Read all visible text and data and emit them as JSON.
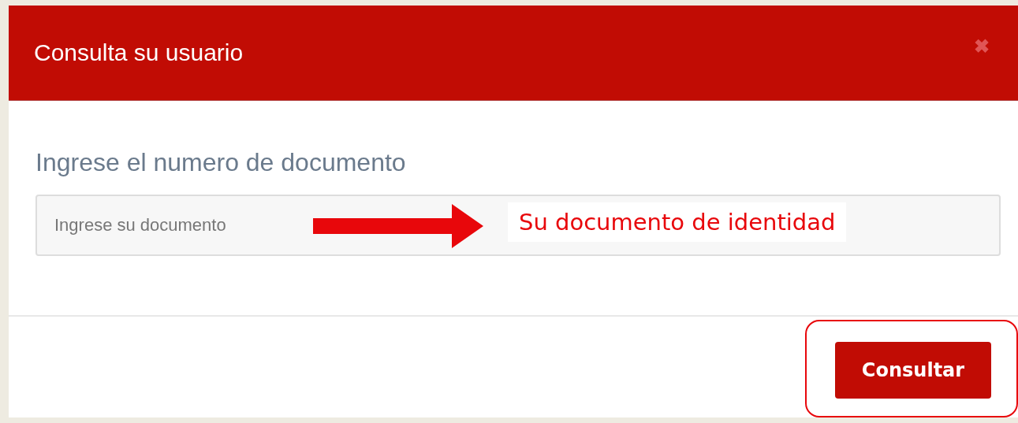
{
  "dialog": {
    "title": "Consulta su usuario",
    "close_icon": "✖"
  },
  "form": {
    "label": "Ingrese el numero de documento",
    "field": {
      "placeholder": "Ingrese su documento"
    }
  },
  "annotation": {
    "text": "Su documento de identidad"
  },
  "footer": {
    "button": {
      "label": "Consultar",
      "highlighted": true
    }
  }
}
